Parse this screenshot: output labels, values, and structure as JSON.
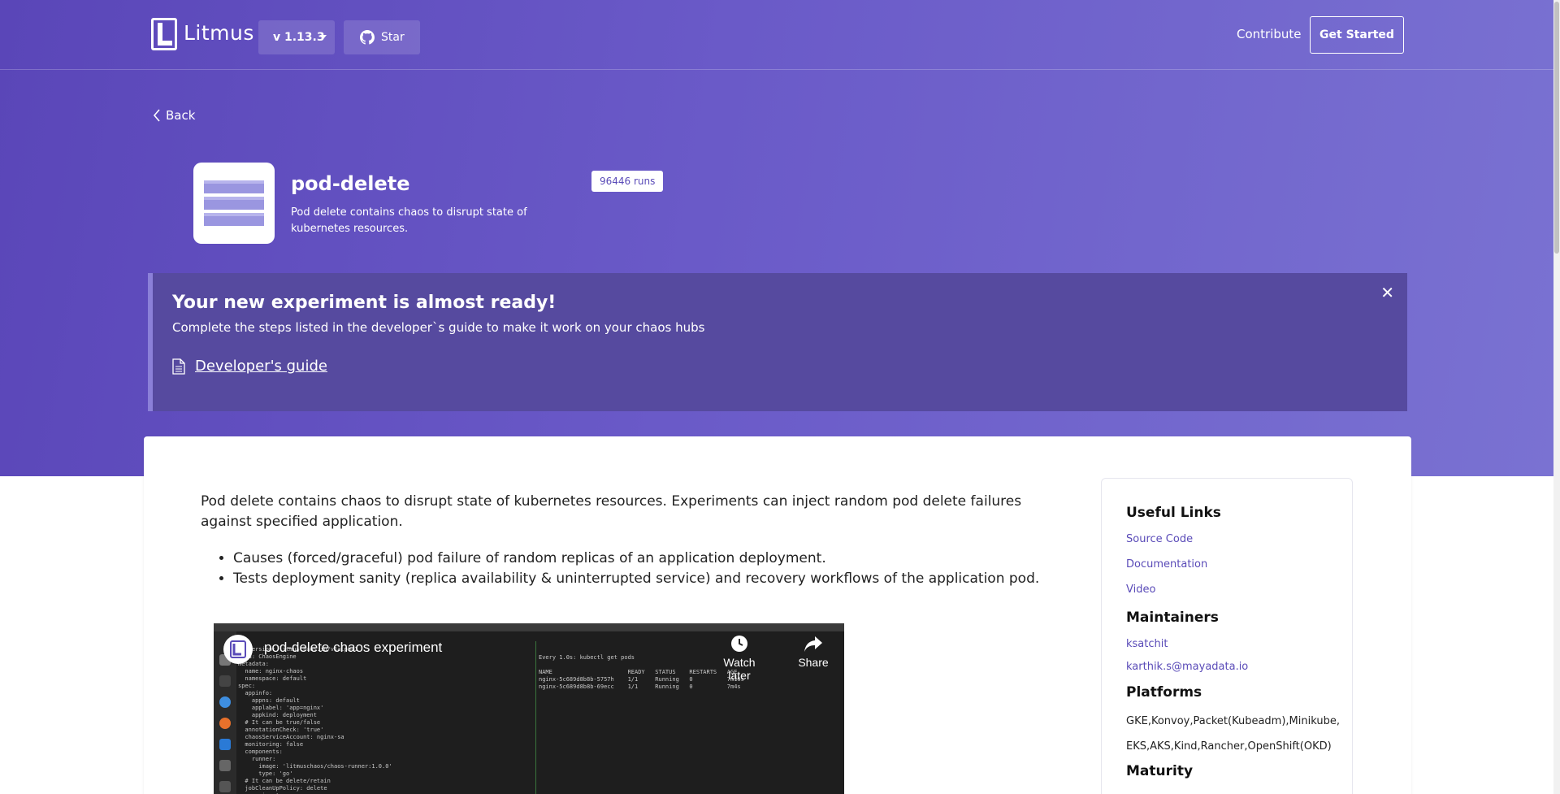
{
  "nav": {
    "logo_text": "Litmus",
    "version": "v 1.13.3",
    "star_label": "Star",
    "contribute": "Contribute",
    "get_started": "Get Started"
  },
  "back_label": "Back",
  "experiment": {
    "title": "pod-delete",
    "description": "Pod delete contains chaos to disrupt state of kubernetes resources.",
    "runs": "96446 runs"
  },
  "notice": {
    "title": "Your new experiment is almost ready!",
    "text": "Complete the steps listed in the developer`s guide to make it work on your chaos hubs",
    "link": "Developer's guide",
    "close": "✕"
  },
  "content": {
    "paragraph": "Pod delete contains chaos to disrupt state of kubernetes resources. Experiments can inject random pod delete failures against specified application.",
    "bullets": [
      "Causes (forced/graceful) pod failure of random replicas of an application deployment.",
      "Tests deployment sanity (replica availability & uninterrupted service) and recovery workflows of the application pod."
    ],
    "video": {
      "title": "pod-delete chaos experiment",
      "watch_later": "Watch later",
      "share": "Share"
    }
  },
  "sidebar": {
    "useful_links_heading": "Useful Links",
    "links": [
      "Source Code",
      "Documentation",
      "Video"
    ],
    "maintainers_heading": "Maintainers",
    "maintainers": [
      "ksatchit",
      "karthik.s@mayadata.io"
    ],
    "platforms_heading": "Platforms",
    "platforms": "GKE,Konvoy,Packet(Kubeadm),Minikube, EKS,AKS,Kind,Rancher,OpenShift(OKD)",
    "maturity_heading": "Maturity"
  },
  "colors": {
    "hero_start": "#5a46b8",
    "hero_end": "#7a72d2",
    "notice_bg": "#564a9f",
    "link": "#5a4bb8"
  }
}
